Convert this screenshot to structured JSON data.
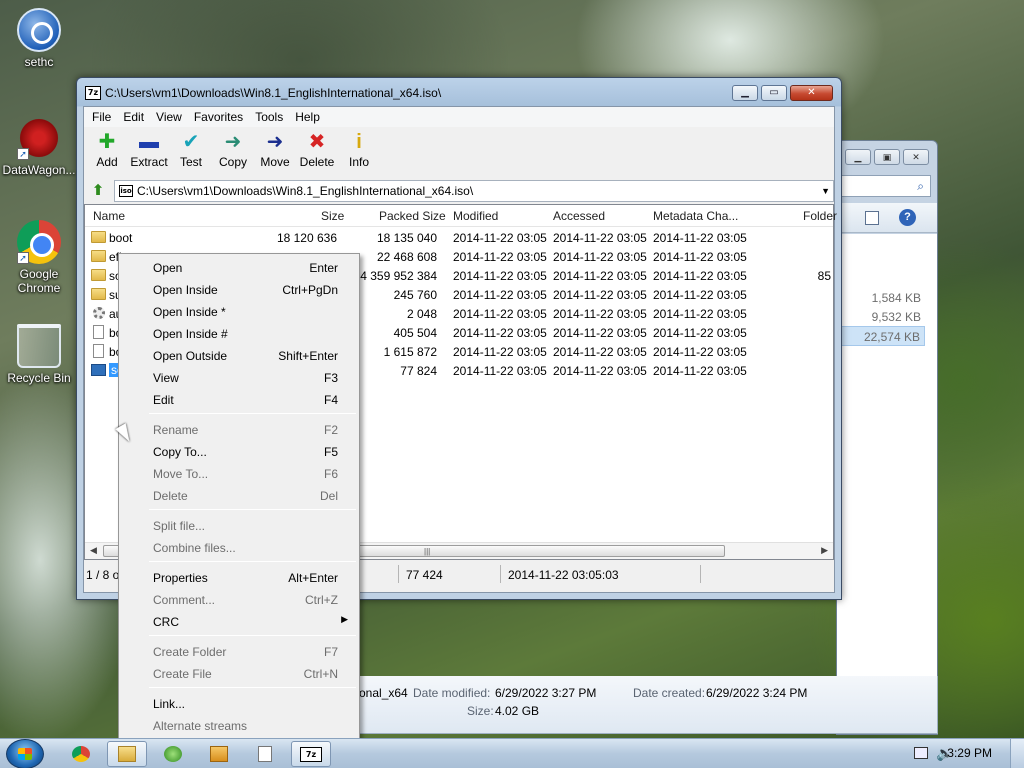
{
  "desktop": {
    "icons": [
      {
        "label": "sethc",
        "icon": "sethc-icon"
      },
      {
        "label": "DataWagon...",
        "icon": "datawagon-icon"
      },
      {
        "label": "Google Chrome",
        "icon": "chrome-icon"
      },
      {
        "label": "Recycle Bin",
        "icon": "recycle-bin-icon"
      }
    ]
  },
  "explorer": {
    "sizes": [
      "1,584 KB",
      "9,532 KB",
      "22,574 KB"
    ],
    "partial_text": "e",
    "details": {
      "name_partial": "onal_x64",
      "date_modified_label": "Date modified:",
      "date_modified": "6/29/2022 3:27 PM",
      "date_created_label": "Date created:",
      "date_created": "6/29/2022 3:24 PM",
      "size_label": "Size:",
      "size": "4.02 GB"
    }
  },
  "zip_window": {
    "title": "C:\\Users\\vm1\\Downloads\\Win8.1_EnglishInternational_x64.iso\\",
    "app_icon_text": "7z",
    "menu": [
      "File",
      "Edit",
      "View",
      "Favorites",
      "Tools",
      "Help"
    ],
    "toolbar": [
      {
        "label": "Add",
        "icon": "add-icon",
        "glyph": "✚",
        "color": "#22a82a"
      },
      {
        "label": "Extract",
        "icon": "extract-icon",
        "glyph": "▬",
        "color": "#1f3fae"
      },
      {
        "label": "Test",
        "icon": "test-icon",
        "glyph": "✔",
        "color": "#18a3b8"
      },
      {
        "label": "Copy",
        "icon": "copy-icon",
        "glyph": "➜",
        "color": "#2a8c74"
      },
      {
        "label": "Move",
        "icon": "move-icon",
        "glyph": "➜",
        "color": "#1b2f8f"
      },
      {
        "label": "Delete",
        "icon": "delete-icon",
        "glyph": "✖",
        "color": "#d62424"
      },
      {
        "label": "Info",
        "icon": "info-icon",
        "glyph": "i",
        "color": "#d7a90e"
      }
    ],
    "address": "C:\\Users\\vm1\\Downloads\\Win8.1_EnglishInternational_x64.iso\\",
    "columns": [
      "Name",
      "Size",
      "Packed Size",
      "Modified",
      "Accessed",
      "Metadata Cha...",
      "Folder"
    ],
    "rows": [
      {
        "name": "boot",
        "type": "folder",
        "size": "18 120 636",
        "packed": "18 135 040",
        "modified": "2014-11-22 03:05",
        "accessed": "2014-11-22 03:05",
        "metadata": "2014-11-22 03:05",
        "folders": ""
      },
      {
        "name": "efi",
        "type": "folder",
        "size": "",
        "packed": "22 468 608",
        "modified": "2014-11-22 03:05",
        "accessed": "2014-11-22 03:05",
        "metadata": "2014-11-22 03:05",
        "folders": ""
      },
      {
        "name": "so",
        "type": "folder",
        "size": "",
        "packed": "4 359 952 384",
        "modified": "2014-11-22 03:05",
        "accessed": "2014-11-22 03:05",
        "metadata": "2014-11-22 03:05",
        "folders": "85"
      },
      {
        "name": "su",
        "type": "folder",
        "size": "",
        "packed": "245 760",
        "modified": "2014-11-22 03:05",
        "accessed": "2014-11-22 03:05",
        "metadata": "2014-11-22 03:05",
        "folders": ""
      },
      {
        "name": "au",
        "type": "gear",
        "size": "",
        "packed": "2 048",
        "modified": "2014-11-22 03:05",
        "accessed": "2014-11-22 03:05",
        "metadata": "2014-11-22 03:05",
        "folders": ""
      },
      {
        "name": "bo",
        "type": "file",
        "size": "",
        "packed": "405 504",
        "modified": "2014-11-22 03:05",
        "accessed": "2014-11-22 03:05",
        "metadata": "2014-11-22 03:05",
        "folders": ""
      },
      {
        "name": "bo",
        "type": "file",
        "size": "",
        "packed": "1 615 872",
        "modified": "2014-11-22 03:05",
        "accessed": "2014-11-22 03:05",
        "metadata": "2014-11-22 03:05",
        "folders": ""
      },
      {
        "name": "se",
        "type": "setup",
        "size": "",
        "packed": "77 824",
        "modified": "2014-11-22 03:05",
        "accessed": "2014-11-22 03:05",
        "metadata": "2014-11-22 03:05",
        "folders": "",
        "selected": true
      }
    ],
    "status": {
      "selection": "1 / 8 o",
      "packed": "77 424",
      "modified": "2014-11-22 03:05:03"
    }
  },
  "context_menu": {
    "items": [
      {
        "label": "Open",
        "shortcut": "Enter",
        "disabled": false
      },
      {
        "label": "Open Inside",
        "shortcut": "Ctrl+PgDn",
        "disabled": false
      },
      {
        "label": "Open Inside *",
        "shortcut": "",
        "disabled": false
      },
      {
        "label": "Open Inside #",
        "shortcut": "",
        "disabled": false
      },
      {
        "label": "Open Outside",
        "shortcut": "Shift+Enter",
        "disabled": false
      },
      {
        "label": "View",
        "shortcut": "F3",
        "disabled": false
      },
      {
        "label": "Edit",
        "shortcut": "F4",
        "disabled": false
      },
      {
        "separator": true
      },
      {
        "label": "Rename",
        "shortcut": "F2",
        "disabled": true
      },
      {
        "label": "Copy To...",
        "shortcut": "F5",
        "disabled": false
      },
      {
        "label": "Move To...",
        "shortcut": "F6",
        "disabled": true
      },
      {
        "label": "Delete",
        "shortcut": "Del",
        "disabled": true
      },
      {
        "separator": true
      },
      {
        "label": "Split file...",
        "shortcut": "",
        "disabled": true
      },
      {
        "label": "Combine files...",
        "shortcut": "",
        "disabled": true
      },
      {
        "separator": true
      },
      {
        "label": "Properties",
        "shortcut": "Alt+Enter",
        "disabled": false
      },
      {
        "label": "Comment...",
        "shortcut": "Ctrl+Z",
        "disabled": true
      },
      {
        "label": "CRC",
        "shortcut": "",
        "disabled": false,
        "submenu": true
      },
      {
        "separator": true
      },
      {
        "label": "Create Folder",
        "shortcut": "F7",
        "disabled": true
      },
      {
        "label": "Create File",
        "shortcut": "Ctrl+N",
        "disabled": true
      },
      {
        "separator": true
      },
      {
        "label": "Link...",
        "shortcut": "",
        "disabled": false
      },
      {
        "label": "Alternate streams",
        "shortcut": "",
        "disabled": true
      }
    ]
  },
  "taskbar": {
    "buttons": [
      {
        "name": "taskbar-chrome",
        "icon": "chrome-icon",
        "cls": "chrome",
        "active": false
      },
      {
        "name": "taskbar-explorer",
        "icon": "folder-icon",
        "cls": "explorer",
        "active": true
      },
      {
        "name": "taskbar-media-center",
        "icon": "media-center-icon",
        "cls": "media",
        "active": false
      },
      {
        "name": "taskbar-media-player",
        "icon": "media-player-icon",
        "cls": "wmp",
        "active": false
      },
      {
        "name": "taskbar-notepad",
        "icon": "notepad-icon",
        "cls": "note",
        "active": false
      },
      {
        "name": "taskbar-7zip",
        "icon": "7zip-icon",
        "cls": "zip",
        "active": true,
        "text": "7z"
      }
    ],
    "clock": "3:29 PM"
  }
}
